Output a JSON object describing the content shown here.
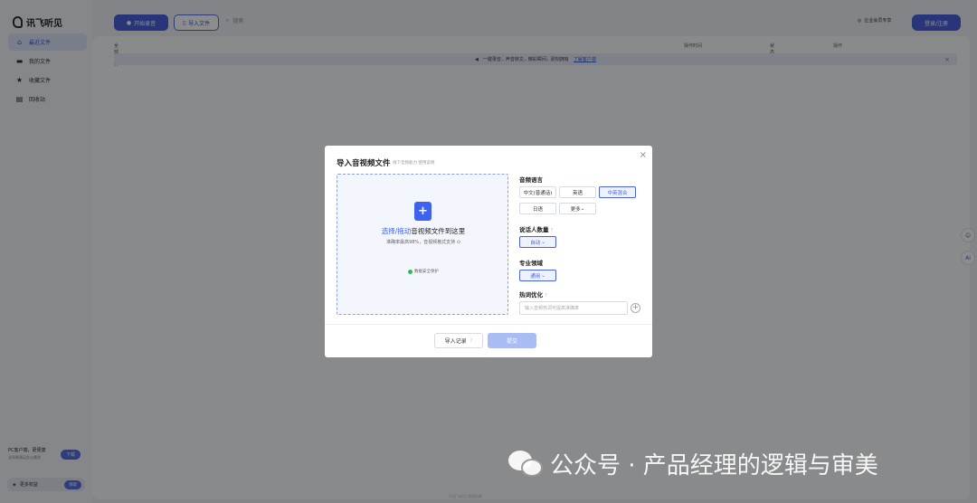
{
  "app": {
    "logo_text": "讯飞听见"
  },
  "sidebar": {
    "items": [
      {
        "label": "最近文件",
        "icon": "home-icon"
      },
      {
        "label": "我的文件",
        "icon": "folder-icon"
      },
      {
        "label": "收藏文件",
        "icon": "star-icon"
      },
      {
        "label": "回收站",
        "icon": "trash-icon"
      }
    ],
    "pc_promo": {
      "line1": "PC客户端，更便捷",
      "line2": "全场景满足办公需求",
      "button": "下载"
    },
    "more_privileges": {
      "label": "更多权益",
      "button": "领取"
    }
  },
  "topbar": {
    "record_button": "开始录音",
    "import_button": "导入文件",
    "search_placeholder": "搜索",
    "right_link": "企业会员专享",
    "login_button": "登录/注册"
  },
  "table": {
    "col_name": "全部文件",
    "col_time": "操作时间",
    "col_type": "状态",
    "col_action": "操作"
  },
  "banner": {
    "text": "一键录音，声音转文，精彩瞬间，即刻拥有",
    "link": "了解客户端"
  },
  "footer_note": "©讯飞听见 版权所有",
  "dialog": {
    "title": "导入音视频文件",
    "subtitle": "线下音频能力 使用说明",
    "upload": {
      "main_emphasis": "选择/拖动",
      "main_rest": "音视频文件到这里",
      "hint": "准确率最高98%，音视频格式支持",
      "safe": "数据安全保护"
    },
    "audio_language": {
      "label": "音频语言",
      "options": [
        "中文(普通话)",
        "英语",
        "中英混合",
        "日语",
        "更多"
      ],
      "selected": "中英混合"
    },
    "speakers": {
      "label": "说话人数量",
      "value": "自动"
    },
    "domain": {
      "label": "专业领域",
      "value": "通用"
    },
    "hotwords": {
      "label": "热词优化",
      "placeholder": "输入音频热词可提高准确率"
    },
    "history_button": "导入记录",
    "submit_button": "提交"
  },
  "watermark": "公众号 · 产品经理的逻辑与审美"
}
